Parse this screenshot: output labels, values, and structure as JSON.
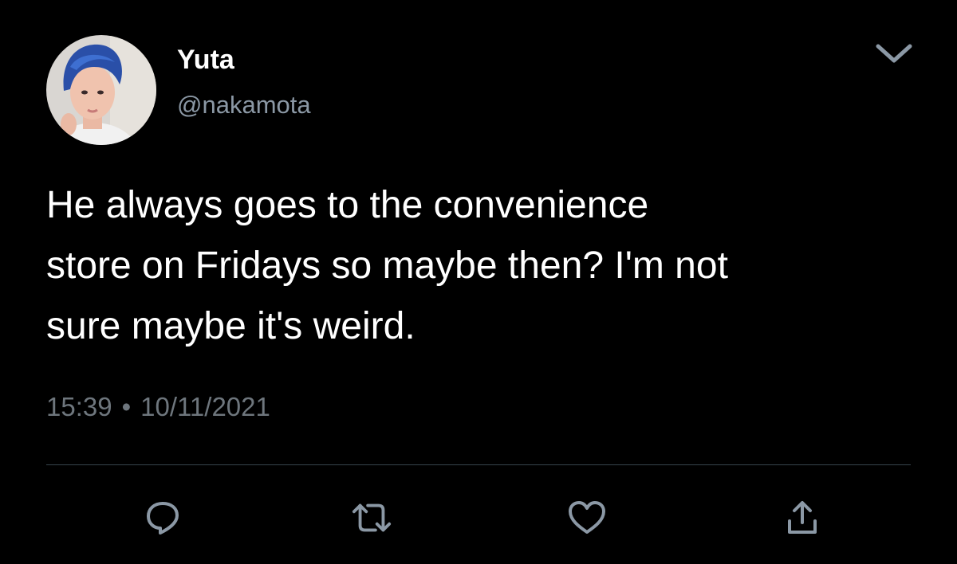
{
  "author": {
    "display_name": "Yuta",
    "handle": "@nakamota",
    "avatar_icon": "profile-photo"
  },
  "tweet": {
    "text": "He always goes to the convenience\nstore on Fridays so maybe then? I'm not\nsure maybe it's weird.",
    "time": "15:39",
    "separator": "•",
    "date": "10/11/2021"
  },
  "actions": [
    {
      "icon": "reply-icon"
    },
    {
      "icon": "retweet-icon"
    },
    {
      "icon": "like-icon"
    },
    {
      "icon": "share-icon"
    }
  ],
  "menu": {
    "icon": "chevron-down-icon"
  },
  "colors": {
    "background": "#000000",
    "primary_text": "#ffffff",
    "secondary_text": "#8b98a5",
    "icon": "#8b98a5",
    "divider": "#38444d"
  }
}
